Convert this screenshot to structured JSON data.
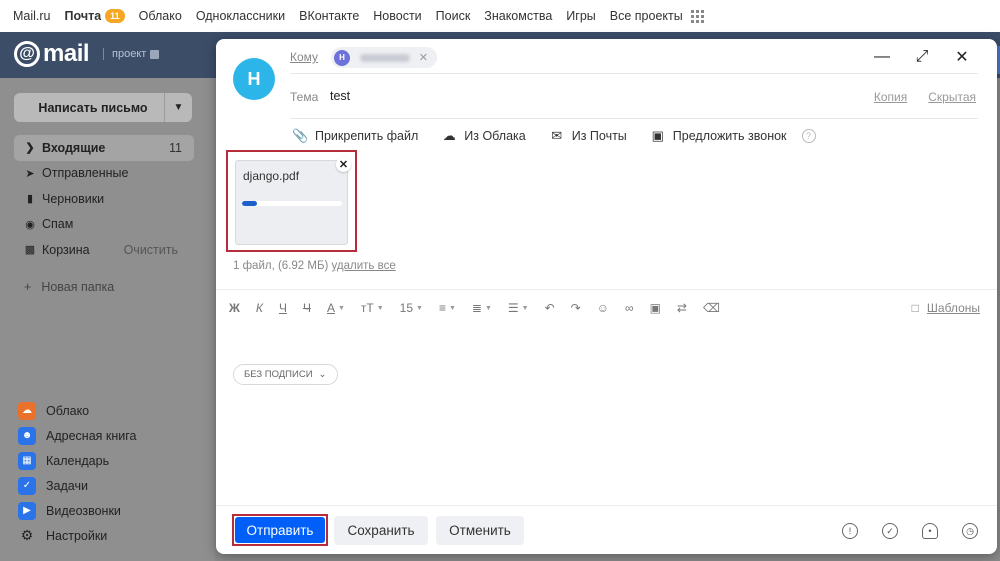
{
  "topbar": {
    "items": [
      "Mail.ru",
      "Почта",
      "Облако",
      "Одноклассники",
      "ВКонтакте",
      "Новости",
      "Поиск",
      "Знакомства",
      "Игры",
      "Все проекты"
    ],
    "mail_badge": "11"
  },
  "header": {
    "logo_at": "@",
    "logo_text": "mail",
    "project_label": "проект"
  },
  "sidebar": {
    "compose_label": "Написать письмо",
    "folders": [
      {
        "label": "Входящие",
        "count": "11",
        "icon": "chevron-right-icon"
      },
      {
        "label": "Отправленные",
        "icon": "send-icon"
      },
      {
        "label": "Черновики",
        "icon": "draft-icon"
      },
      {
        "label": "Спам",
        "icon": "spam-icon"
      },
      {
        "label": "Корзина",
        "action": "Очистить",
        "icon": "trash-icon"
      }
    ],
    "new_folder": "Новая папка",
    "services": [
      {
        "label": "Облако",
        "color": "#2a73e8"
      },
      {
        "label": "Адресная книга",
        "color": "#2a73e8"
      },
      {
        "label": "Календарь",
        "color": "#2a73e8"
      },
      {
        "label": "Задачи",
        "color": "#2a73e8"
      },
      {
        "label": "Видеозвонки",
        "color": "#2a73e8"
      },
      {
        "label": "Настройки",
        "color": "#555555"
      }
    ]
  },
  "compose": {
    "avatar_letter": "H",
    "to_label": "Кому",
    "recipient_initial": "H",
    "subject_label": "Тема",
    "subject_value": "test",
    "copy_label": "Копия",
    "hidden_label": "Скрытая",
    "attach": {
      "file": "Прикрепить файл",
      "cloud": "Из Облака",
      "mail": "Из Почты",
      "call": "Предложить звонок"
    },
    "file": {
      "name": "django.pdf",
      "progress": 0.15
    },
    "file_summary": "1 файл, (6.92 МБ)",
    "delete_all": "удалить все",
    "toolbar": {
      "bold": "Ж",
      "italic": "К",
      "underline": "Ч",
      "strike": "Ч",
      "font_color": "А",
      "font_size_label": "тТ",
      "size": "15"
    },
    "templates": "Шаблоны",
    "signature": "БЕЗ ПОДПИСИ",
    "send": "Отправить",
    "save": "Сохранить",
    "cancel": "Отменить"
  },
  "colors": {
    "accent": "#005ff9",
    "highlight_border": "#b72c3a",
    "avatar": "#2cb5e8"
  }
}
